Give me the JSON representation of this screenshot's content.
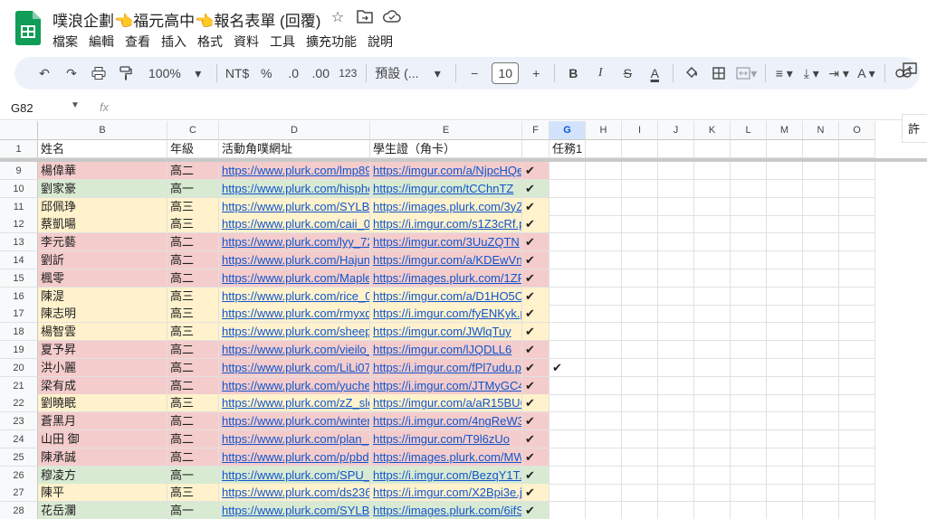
{
  "app": {
    "title": "噗浪企劃👈福元高中👈報名表單 (回覆)",
    "menu": [
      "檔案",
      "編輯",
      "查看",
      "插入",
      "格式",
      "資料",
      "工具",
      "擴充功能",
      "說明"
    ]
  },
  "toolbar": {
    "zoom": "100%",
    "currency": "NT$",
    "percent": "%",
    "dec_decrease": ".0",
    "dec_increase": ".00",
    "number_format": "123",
    "font": "預設 (...",
    "font_size": "10",
    "minus": "−",
    "plus": "+",
    "bold": "B",
    "italic": "I",
    "strike": "S",
    "text_color": "A"
  },
  "formula": {
    "cell_ref": "G82",
    "fx": "fx"
  },
  "side_panel_label": "許",
  "colors": {
    "pink": "#f4cccc",
    "green": "#d9ead3",
    "yellow": "#fff2cc",
    "link": "#1155cc",
    "selected_header": "#d3e3fd"
  },
  "columns": [
    "B",
    "C",
    "D",
    "E",
    "F",
    "G",
    "H",
    "I",
    "J",
    "K",
    "L",
    "M",
    "N",
    "O"
  ],
  "header_row": {
    "num": "1",
    "b": "姓名",
    "c": "年級",
    "d": "活動角噗網址",
    "e": "學生證（角卡）",
    "f": "",
    "g": "任務1"
  },
  "rows": [
    {
      "num": "9",
      "name": "楊偉華",
      "grade": "高二",
      "plurk": "https://www.plurk.com/lmp891",
      "img": "https://imgur.com/a/NjpcHQe",
      "f": "✔",
      "g": "",
      "color": "pink"
    },
    {
      "num": "10",
      "name": "劉家豪",
      "grade": "高一",
      "plurk": "https://www.plurk.com/hisphen",
      "img": "https://imgur.com/tCChnTZ",
      "f": "✔",
      "g": "",
      "color": "green"
    },
    {
      "num": "11",
      "name": "邱佩琤",
      "grade": "高三",
      "plurk": "https://www.plurk.com/SYLB_",
      "img": "https://images.plurk.com/3yZe",
      "f": "✔",
      "g": "",
      "color": "yellow"
    },
    {
      "num": "12",
      "name": "蔡凱暘",
      "grade": "高三",
      "plurk": "https://www.plurk.com/caii_00",
      "img": "https://i.imgur.com/s1Z3cRf.p",
      "f": "✔",
      "g": "",
      "color": "yellow"
    },
    {
      "num": "13",
      "name": "李元藝",
      "grade": "高二",
      "plurk": "https://www.plurk.com/lyy_72",
      "img": "https://imgur.com/3UuZQTN",
      "f": "✔",
      "g": "",
      "color": "pink"
    },
    {
      "num": "14",
      "name": "劉訢",
      "grade": "高二",
      "plurk": "https://www.plurk.com/Hajun_",
      "img": "https://imgur.com/a/KDEwVnL",
      "f": "✔",
      "g": "",
      "color": "pink"
    },
    {
      "num": "15",
      "name": "楓零",
      "grade": "高二",
      "plurk": "https://www.plurk.com/MapleS",
      "img": "https://images.plurk.com/1ZP",
      "f": "✔",
      "g": "",
      "color": "pink"
    },
    {
      "num": "16",
      "name": "陳湜",
      "grade": "高三",
      "plurk": "https://www.plurk.com/rice_09",
      "img": "https://imgur.com/a/D1HO5OI",
      "f": "✔",
      "g": "",
      "color": "yellow"
    },
    {
      "num": "17",
      "name": "陳志明",
      "grade": "高三",
      "plurk": "https://www.plurk.com/rmyxdc",
      "img": "https://i.imgur.com/fyENKyk.p",
      "f": "✔",
      "g": "",
      "color": "yellow"
    },
    {
      "num": "18",
      "name": "楊智雲",
      "grade": "高三",
      "plurk": "https://www.plurk.com/sheepo",
      "img": "https://imgur.com/JWlqTuy",
      "f": "✔",
      "g": "",
      "color": "yellow"
    },
    {
      "num": "19",
      "name": "夏予昇",
      "grade": "高二",
      "plurk": "https://www.plurk.com/vieilo_",
      "img": "https://imgur.com/lJQDLL6",
      "f": "✔",
      "g": "",
      "color": "pink"
    },
    {
      "num": "20",
      "name": "洪小麗",
      "grade": "高二",
      "plurk": "https://www.plurk.com/LiLi072",
      "img": "https://i.imgur.com/fPl7udu.pn",
      "f": "✔",
      "g": "✔",
      "color": "pink"
    },
    {
      "num": "21",
      "name": "梁有成",
      "grade": "高二",
      "plurk": "https://www.plurk.com/yucher",
      "img": "https://i.imgur.com/JTMyGC4",
      "f": "✔",
      "g": "",
      "color": "pink"
    },
    {
      "num": "22",
      "name": "劉曉眠",
      "grade": "高三",
      "plurk": "https://www.plurk.com/zZ_sle",
      "img": "https://imgur.com/a/aR15BU6",
      "f": "✔",
      "g": "",
      "color": "yellow"
    },
    {
      "num": "23",
      "name": "蒼黑月",
      "grade": "高二",
      "plurk": "https://www.plurk.com/winter0",
      "img": "https://i.imgur.com/4ngReW3.",
      "f": "✔",
      "g": "",
      "color": "pink"
    },
    {
      "num": "24",
      "name": "山田 御",
      "grade": "高二",
      "plurk": "https://www.plurk.com/plan_M",
      "img": "https://imgur.com/T9l6zUo",
      "f": "✔",
      "g": "",
      "color": "pink"
    },
    {
      "num": "25",
      "name": "陳承誠",
      "grade": "高二",
      "plurk": "https://www.plurk.com/p/pbdg",
      "img": "https://images.plurk.com/MWo",
      "f": "✔",
      "g": "",
      "color": "pink"
    },
    {
      "num": "26",
      "name": "穆凌方",
      "grade": "高一",
      "plurk": "https://www.plurk.com/SPU_h",
      "img": "https://i.imgur.com/BezqY1T.p",
      "f": "✔",
      "g": "",
      "color": "green"
    },
    {
      "num": "27",
      "name": "陳平",
      "grade": "高三",
      "plurk": "https://www.plurk.com/ds2365",
      "img": "https://i.imgur.com/X2Bpi3e.jp",
      "f": "✔",
      "g": "",
      "color": "yellow"
    },
    {
      "num": "28",
      "name": "花岳瀾",
      "grade": "高一",
      "plurk": "https://www.plurk.com/SYLB",
      "img": "https://images.plurk.com/6ifS",
      "f": "✔",
      "g": "",
      "color": "green"
    }
  ]
}
